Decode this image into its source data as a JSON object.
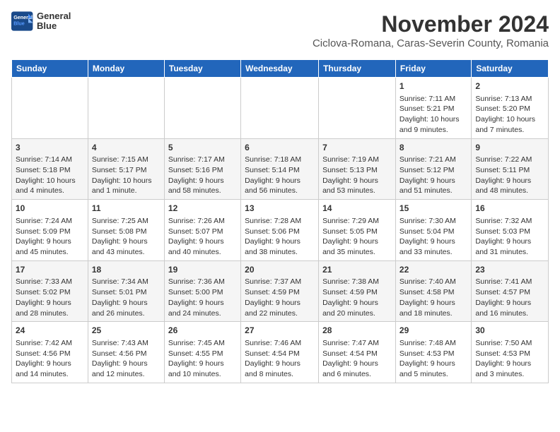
{
  "header": {
    "logo_line1": "General",
    "logo_line2": "Blue",
    "month_title": "November 2024",
    "location": "Ciclova-Romana, Caras-Severin County, Romania"
  },
  "days_of_week": [
    "Sunday",
    "Monday",
    "Tuesday",
    "Wednesday",
    "Thursday",
    "Friday",
    "Saturday"
  ],
  "weeks": [
    [
      {
        "day": "",
        "info": ""
      },
      {
        "day": "",
        "info": ""
      },
      {
        "day": "",
        "info": ""
      },
      {
        "day": "",
        "info": ""
      },
      {
        "day": "",
        "info": ""
      },
      {
        "day": "1",
        "info": "Sunrise: 7:11 AM\nSunset: 5:21 PM\nDaylight: 10 hours and 9 minutes."
      },
      {
        "day": "2",
        "info": "Sunrise: 7:13 AM\nSunset: 5:20 PM\nDaylight: 10 hours and 7 minutes."
      }
    ],
    [
      {
        "day": "3",
        "info": "Sunrise: 7:14 AM\nSunset: 5:18 PM\nDaylight: 10 hours and 4 minutes."
      },
      {
        "day": "4",
        "info": "Sunrise: 7:15 AM\nSunset: 5:17 PM\nDaylight: 10 hours and 1 minute."
      },
      {
        "day": "5",
        "info": "Sunrise: 7:17 AM\nSunset: 5:16 PM\nDaylight: 9 hours and 58 minutes."
      },
      {
        "day": "6",
        "info": "Sunrise: 7:18 AM\nSunset: 5:14 PM\nDaylight: 9 hours and 56 minutes."
      },
      {
        "day": "7",
        "info": "Sunrise: 7:19 AM\nSunset: 5:13 PM\nDaylight: 9 hours and 53 minutes."
      },
      {
        "day": "8",
        "info": "Sunrise: 7:21 AM\nSunset: 5:12 PM\nDaylight: 9 hours and 51 minutes."
      },
      {
        "day": "9",
        "info": "Sunrise: 7:22 AM\nSunset: 5:11 PM\nDaylight: 9 hours and 48 minutes."
      }
    ],
    [
      {
        "day": "10",
        "info": "Sunrise: 7:24 AM\nSunset: 5:09 PM\nDaylight: 9 hours and 45 minutes."
      },
      {
        "day": "11",
        "info": "Sunrise: 7:25 AM\nSunset: 5:08 PM\nDaylight: 9 hours and 43 minutes."
      },
      {
        "day": "12",
        "info": "Sunrise: 7:26 AM\nSunset: 5:07 PM\nDaylight: 9 hours and 40 minutes."
      },
      {
        "day": "13",
        "info": "Sunrise: 7:28 AM\nSunset: 5:06 PM\nDaylight: 9 hours and 38 minutes."
      },
      {
        "day": "14",
        "info": "Sunrise: 7:29 AM\nSunset: 5:05 PM\nDaylight: 9 hours and 35 minutes."
      },
      {
        "day": "15",
        "info": "Sunrise: 7:30 AM\nSunset: 5:04 PM\nDaylight: 9 hours and 33 minutes."
      },
      {
        "day": "16",
        "info": "Sunrise: 7:32 AM\nSunset: 5:03 PM\nDaylight: 9 hours and 31 minutes."
      }
    ],
    [
      {
        "day": "17",
        "info": "Sunrise: 7:33 AM\nSunset: 5:02 PM\nDaylight: 9 hours and 28 minutes."
      },
      {
        "day": "18",
        "info": "Sunrise: 7:34 AM\nSunset: 5:01 PM\nDaylight: 9 hours and 26 minutes."
      },
      {
        "day": "19",
        "info": "Sunrise: 7:36 AM\nSunset: 5:00 PM\nDaylight: 9 hours and 24 minutes."
      },
      {
        "day": "20",
        "info": "Sunrise: 7:37 AM\nSunset: 4:59 PM\nDaylight: 9 hours and 22 minutes."
      },
      {
        "day": "21",
        "info": "Sunrise: 7:38 AM\nSunset: 4:59 PM\nDaylight: 9 hours and 20 minutes."
      },
      {
        "day": "22",
        "info": "Sunrise: 7:40 AM\nSunset: 4:58 PM\nDaylight: 9 hours and 18 minutes."
      },
      {
        "day": "23",
        "info": "Sunrise: 7:41 AM\nSunset: 4:57 PM\nDaylight: 9 hours and 16 minutes."
      }
    ],
    [
      {
        "day": "24",
        "info": "Sunrise: 7:42 AM\nSunset: 4:56 PM\nDaylight: 9 hours and 14 minutes."
      },
      {
        "day": "25",
        "info": "Sunrise: 7:43 AM\nSunset: 4:56 PM\nDaylight: 9 hours and 12 minutes."
      },
      {
        "day": "26",
        "info": "Sunrise: 7:45 AM\nSunset: 4:55 PM\nDaylight: 9 hours and 10 minutes."
      },
      {
        "day": "27",
        "info": "Sunrise: 7:46 AM\nSunset: 4:54 PM\nDaylight: 9 hours and 8 minutes."
      },
      {
        "day": "28",
        "info": "Sunrise: 7:47 AM\nSunset: 4:54 PM\nDaylight: 9 hours and 6 minutes."
      },
      {
        "day": "29",
        "info": "Sunrise: 7:48 AM\nSunset: 4:53 PM\nDaylight: 9 hours and 5 minutes."
      },
      {
        "day": "30",
        "info": "Sunrise: 7:50 AM\nSunset: 4:53 PM\nDaylight: 9 hours and 3 minutes."
      }
    ]
  ]
}
